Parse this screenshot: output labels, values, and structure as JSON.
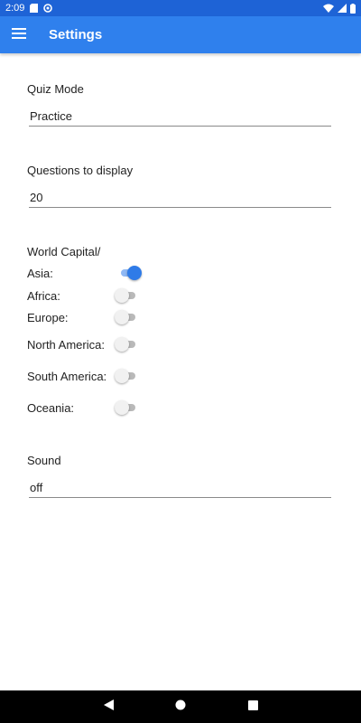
{
  "status_bar": {
    "time": "2:09"
  },
  "app_bar": {
    "title": "Settings"
  },
  "quiz_mode": {
    "label": "Quiz Mode",
    "value": "Practice"
  },
  "questions": {
    "label": "Questions to display",
    "value": "20"
  },
  "world_capital": {
    "label": "World Capital/",
    "regions": [
      {
        "label": "Asia:",
        "on": true
      },
      {
        "label": "Africa:",
        "on": false
      },
      {
        "label": "Europe:",
        "on": false
      },
      {
        "label": "North America:",
        "on": false
      },
      {
        "label": "South America:",
        "on": false
      },
      {
        "label": "Oceania:",
        "on": false
      }
    ]
  },
  "sound": {
    "label": "Sound",
    "value": "off"
  },
  "colors": {
    "accent": "#2f80ed",
    "status_bar": "#1e63d6",
    "switch_on": "#2f7be8"
  }
}
